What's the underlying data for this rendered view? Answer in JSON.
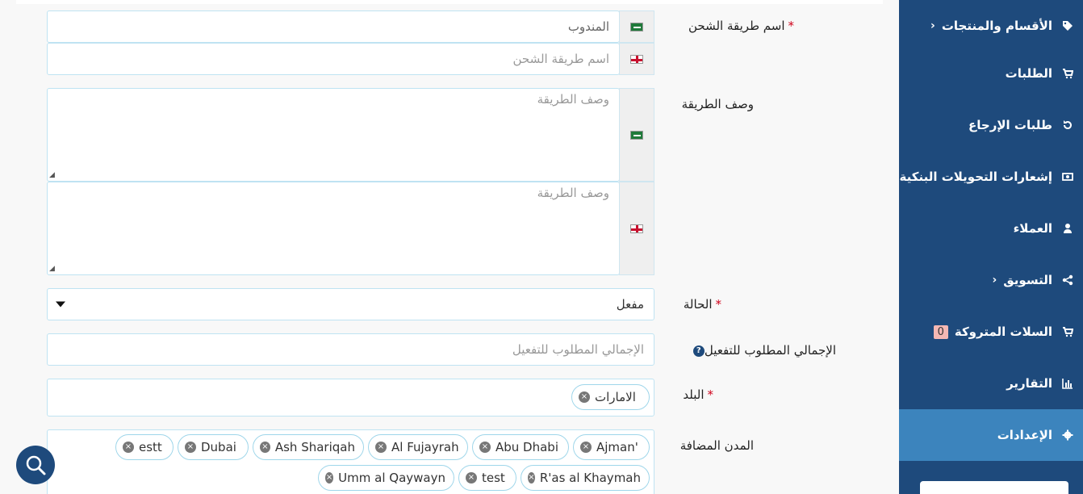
{
  "form": {
    "shipping_name_label": "اسم طريقة الشحن",
    "shipping_name_ar_value": "المندوب",
    "shipping_name_en_placeholder": "اسم طريقة الشحن",
    "description_label": "وصف الطريقة",
    "description_ar_placeholder": "وصف الطريقة",
    "description_en_placeholder": "وصف الطريقة",
    "status_label": "الحالة",
    "status_value": "مفعل",
    "min_total_label": "الإجمالي المطلوب للتفعيل",
    "min_total_placeholder": "الإجمالي المطلوب للتفعيل",
    "country_label": "البلد",
    "country_tags": [
      "الامارات"
    ],
    "cities_label": "المدن المضافة",
    "city_tags": [
      "Ajman'",
      "Abu Dhabi",
      "Al Fujayrah",
      "Ash Shariqah",
      "Dubai",
      "estt",
      "R'as al Khaymah",
      "test",
      "Umm al Qaywayn"
    ],
    "required_mark": "*",
    "help_symbol": "?",
    "remove_symbol": "×"
  },
  "sidebar": {
    "items": [
      {
        "label": "الأقسام والمنتجات",
        "icon": "tag-icon",
        "chevron": "›"
      },
      {
        "label": "الطلبات",
        "icon": "cart-icon"
      },
      {
        "label": "طلبات الإرجاع",
        "icon": "undo-icon"
      },
      {
        "label": "إشعارات التحويلات البنكية",
        "icon": "money-icon"
      },
      {
        "label": "العملاء",
        "icon": "user-icon"
      },
      {
        "label": "التسويق",
        "icon": "share-icon",
        "chevron": "›"
      },
      {
        "label": "السلات المتروكة",
        "icon": "cart-icon",
        "badge": "0"
      },
      {
        "label": "التقارير",
        "icon": "bar-chart-icon"
      },
      {
        "label": "الإعدادات",
        "icon": "gear-icon",
        "active": true
      }
    ]
  },
  "colors": {
    "sidebar_bg": "#1e4a7c",
    "sidebar_active": "#3c84bd",
    "required": "#d0021b",
    "input_border": "#bfe3f2"
  }
}
